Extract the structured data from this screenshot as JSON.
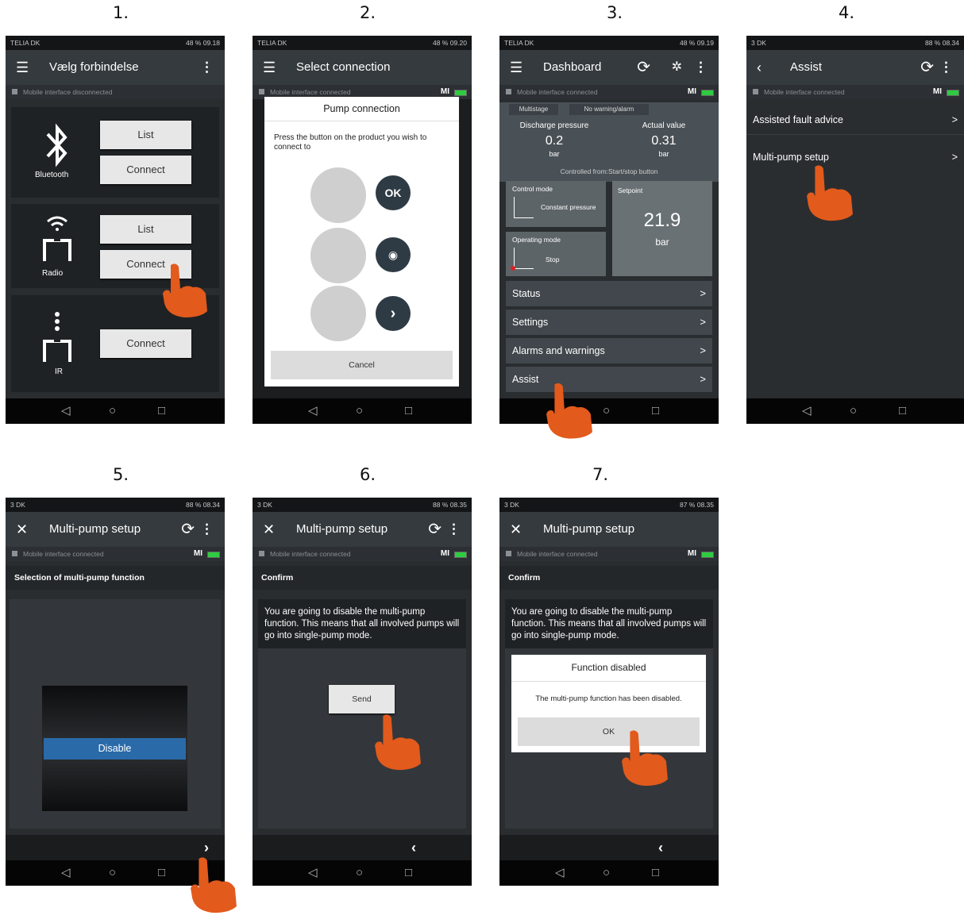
{
  "steps": [
    "1.",
    "2.",
    "3.",
    "4.",
    "5.",
    "6.",
    "7."
  ],
  "colors": {
    "accent": "#e25a1c",
    "disable_blue": "#2a6aa8",
    "battery": "#2ecc40"
  },
  "screen1": {
    "status_left": "TELIA DK",
    "status_right": "48 % 09.18",
    "title": "Vælg forbindelse",
    "conn": "Mobile interface disconnected",
    "bluetooth_label": "Bluetooth",
    "radio_label": "Radio",
    "ir_label": "IR",
    "list": "List",
    "connect": "Connect"
  },
  "screen2": {
    "status_left": "TELIA DK",
    "status_right": "48 % 09.20",
    "title": "Select connection",
    "conn": "Mobile interface connected",
    "mi": "MI",
    "dialog_title": "Pump connection",
    "dialog_text": "Press the button on the product you wish to connect to",
    "ok": "OK",
    "cancel": "Cancel"
  },
  "screen3": {
    "status_left": "TELIA DK",
    "status_right": "48 % 09.19",
    "title": "Dashboard",
    "conn": "Mobile interface connected",
    "mi": "MI",
    "tab1": "Multistage",
    "tab2": "No warning/alarm",
    "discharge_label": "Discharge pressure",
    "discharge_value": "0.2",
    "discharge_unit": "bar",
    "actual_label": "Actual value",
    "actual_value": "0.31",
    "actual_unit": "bar",
    "controlled_from": "Controlled from:Start/stop button",
    "control_mode_label": "Control mode",
    "control_mode_value": "Constant pressure",
    "operating_mode_label": "Operating mode",
    "operating_mode_value": "Stop",
    "setpoint_label": "Setpoint",
    "setpoint_value": "21.9",
    "setpoint_unit": "bar",
    "menu": [
      "Status",
      "Settings",
      "Alarms and warnings",
      "Assist"
    ]
  },
  "screen4": {
    "status_left": "3 DK",
    "status_right": "88 % 08.34",
    "title": "Assist",
    "conn": "Mobile interface connected",
    "mi": "MI",
    "items": [
      "Assisted fault advice",
      "Multi-pump setup"
    ]
  },
  "screen5": {
    "status_left": "3 DK",
    "status_right": "88 % 08.34",
    "title": "Multi-pump setup",
    "conn": "Mobile interface connected",
    "mi": "MI",
    "section": "Selection of multi-pump function",
    "option": "Disable"
  },
  "screen6": {
    "status_left": "3 DK",
    "status_right": "88 % 08.35",
    "title": "Multi-pump setup",
    "conn": "Mobile interface connected",
    "mi": "MI",
    "section": "Confirm",
    "message": "You are going to disable the multi-pump function. This means that all involved pumps will go into single-pump mode.",
    "send": "Send"
  },
  "screen7": {
    "status_left": "3 DK",
    "status_right": "87 % 08.35",
    "title": "Multi-pump setup",
    "conn": "Mobile interface connected",
    "mi": "MI",
    "section": "Confirm",
    "message": "You are going to disable the multi-pump function. This means that all involved pumps will go into single-pump mode.",
    "dialog_title": "Function disabled",
    "dialog_text": "The multi-pump function has been disabled.",
    "ok": "OK"
  }
}
